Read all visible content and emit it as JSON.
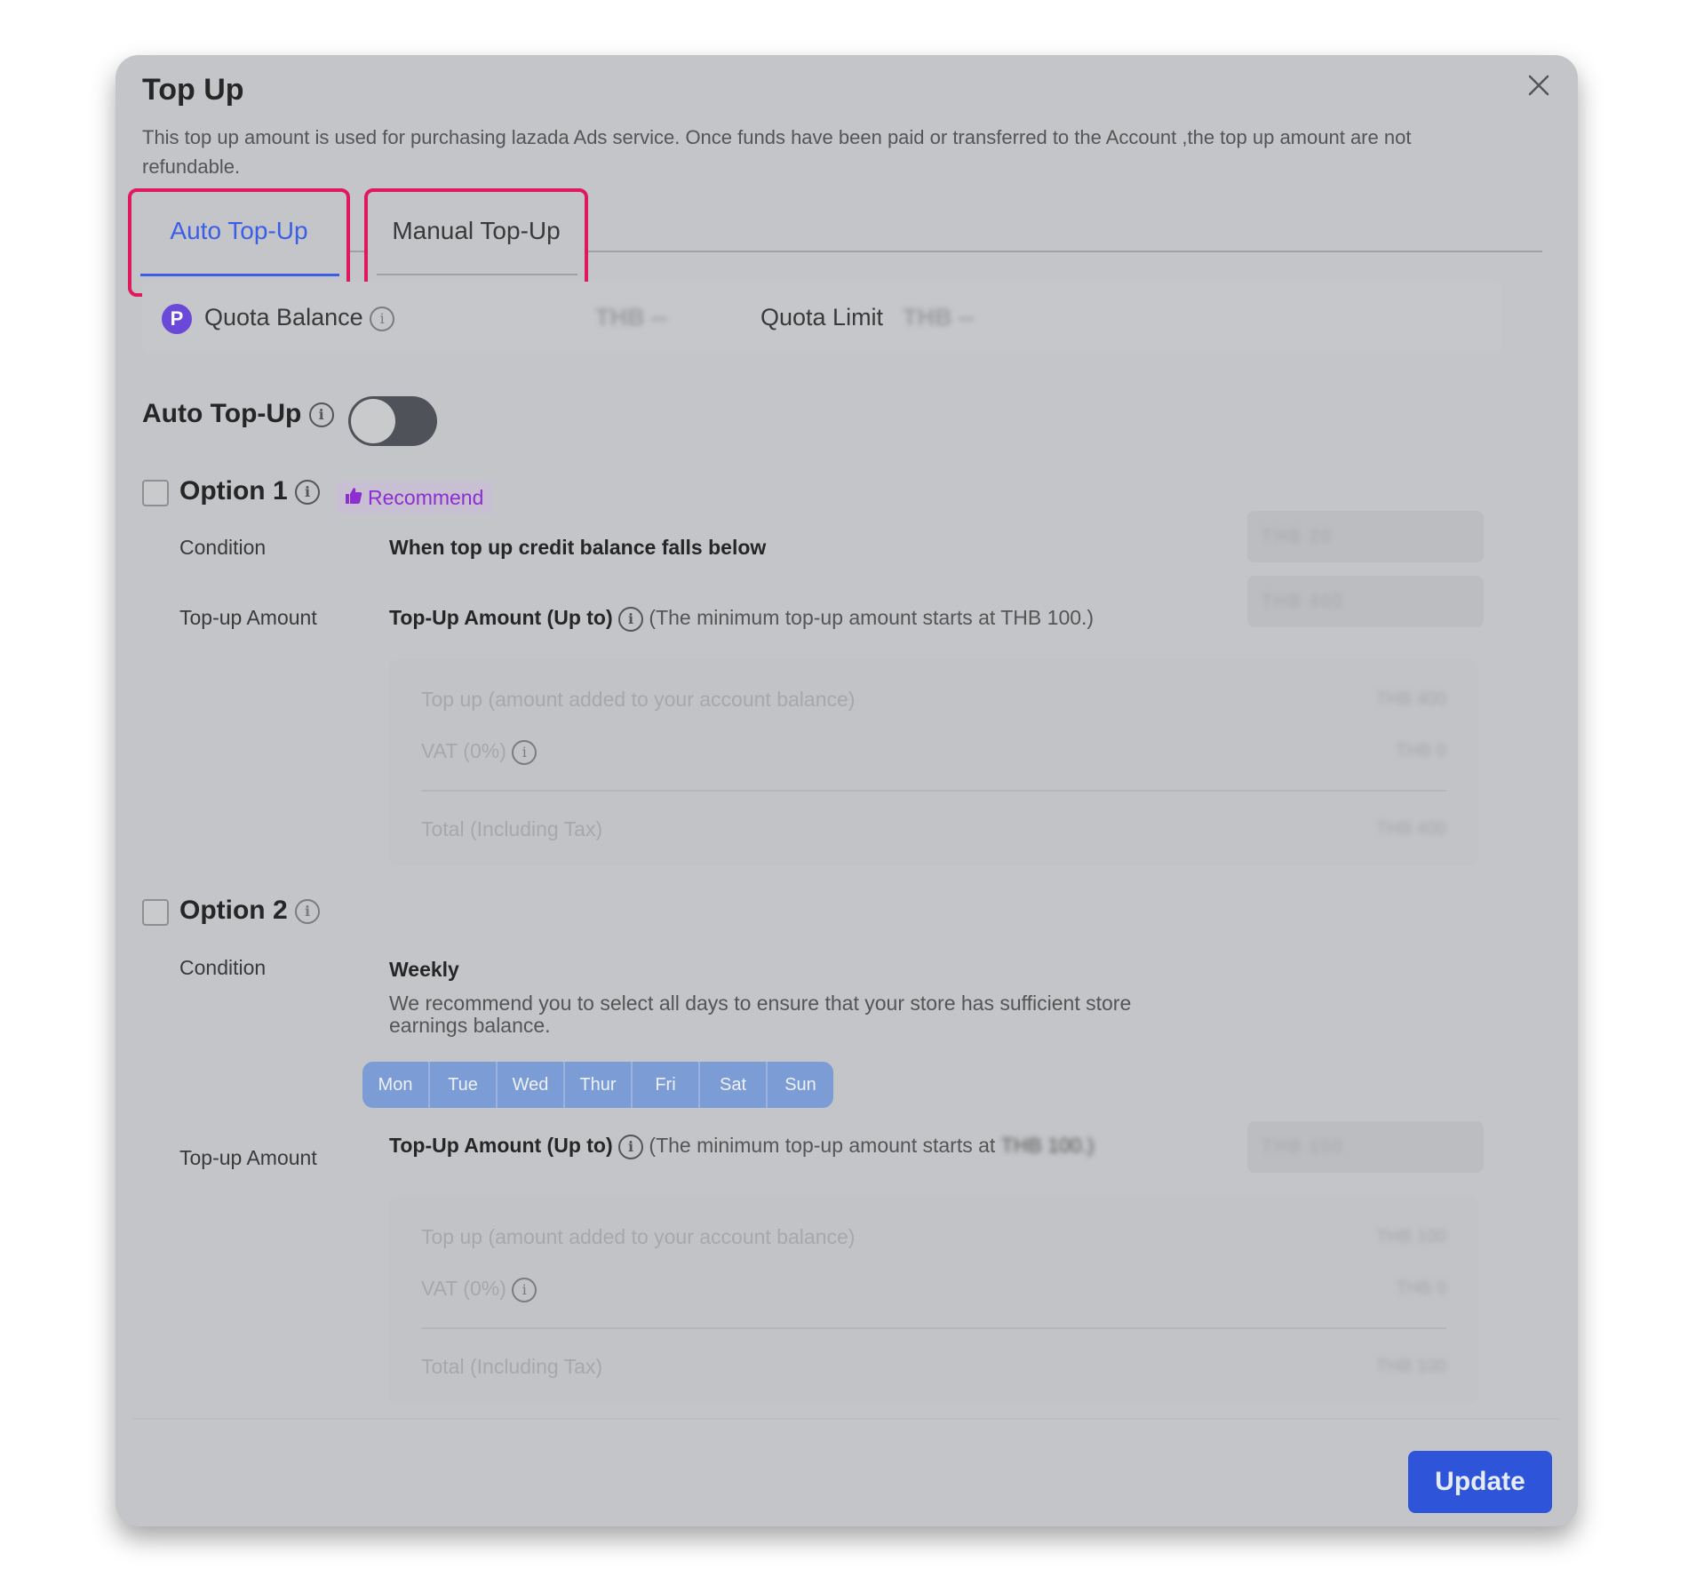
{
  "dialog": {
    "title": "Top Up",
    "description": "This top up amount is used for purchasing lazada Ads service. Once funds have been paid or transferred to the Account ,the top up amount are not refundable."
  },
  "tabs": [
    {
      "label": "Auto Top-Up",
      "active": true
    },
    {
      "label": "Manual Top-Up",
      "active": false
    }
  ],
  "quota": {
    "icon_letter": "P",
    "balance_label": "Quota Balance",
    "balance_value": "THB --",
    "limit_label": "Quota Limit",
    "limit_value": "THB --"
  },
  "auto_topup": {
    "label": "Auto Top-Up",
    "enabled": false
  },
  "option1": {
    "title": "Option 1",
    "badge": "Recommend",
    "condition_label": "Condition",
    "condition_text": "When top up credit balance falls below",
    "condition_input": "THB 20",
    "amount_label": "Top-up Amount",
    "amount_title": "Top-Up Amount (Up to)",
    "amount_hint": "(The minimum top-up amount starts at THB 100.)",
    "amount_input": "THB 400",
    "summary": {
      "topup_label": "Top up (amount added to your account balance)",
      "topup_value": "THB 400",
      "vat_label": "VAT (0%)",
      "vat_value": "THB 0",
      "total_label": "Total (Including Tax)",
      "total_value": "THB 400"
    }
  },
  "option2": {
    "title": "Option 2",
    "condition_label": "Condition",
    "condition_text": "Weekly",
    "condition_note": "We recommend you to select all days to ensure that your store has sufficient store earnings balance.",
    "days": [
      "Mon",
      "Tue",
      "Wed",
      "Thur",
      "Fri",
      "Sat",
      "Sun"
    ],
    "amount_label": "Top-up Amount",
    "amount_title": "Top-Up Amount (Up to)",
    "amount_hint": "(The minimum top-up amount starts at",
    "amount_hint_value": "THB 100.)",
    "amount_input": "THB 100",
    "summary": {
      "topup_label": "Top up (amount added to your account balance)",
      "topup_value": "THB 100",
      "vat_label": "VAT (0%)",
      "vat_value": "THB 0",
      "total_label": "Total (Including Tax)",
      "total_value": "THB 100"
    }
  },
  "footer": {
    "update_label": "Update"
  },
  "colors": {
    "accent": "#2e54d9",
    "tab_highlight": "#e0195c",
    "recommend": "#8d2fd0",
    "overlay": "#c4c5c8"
  },
  "icons": [
    "close-icon",
    "info-icon",
    "thumbs-up-icon",
    "quota-p-icon"
  ]
}
